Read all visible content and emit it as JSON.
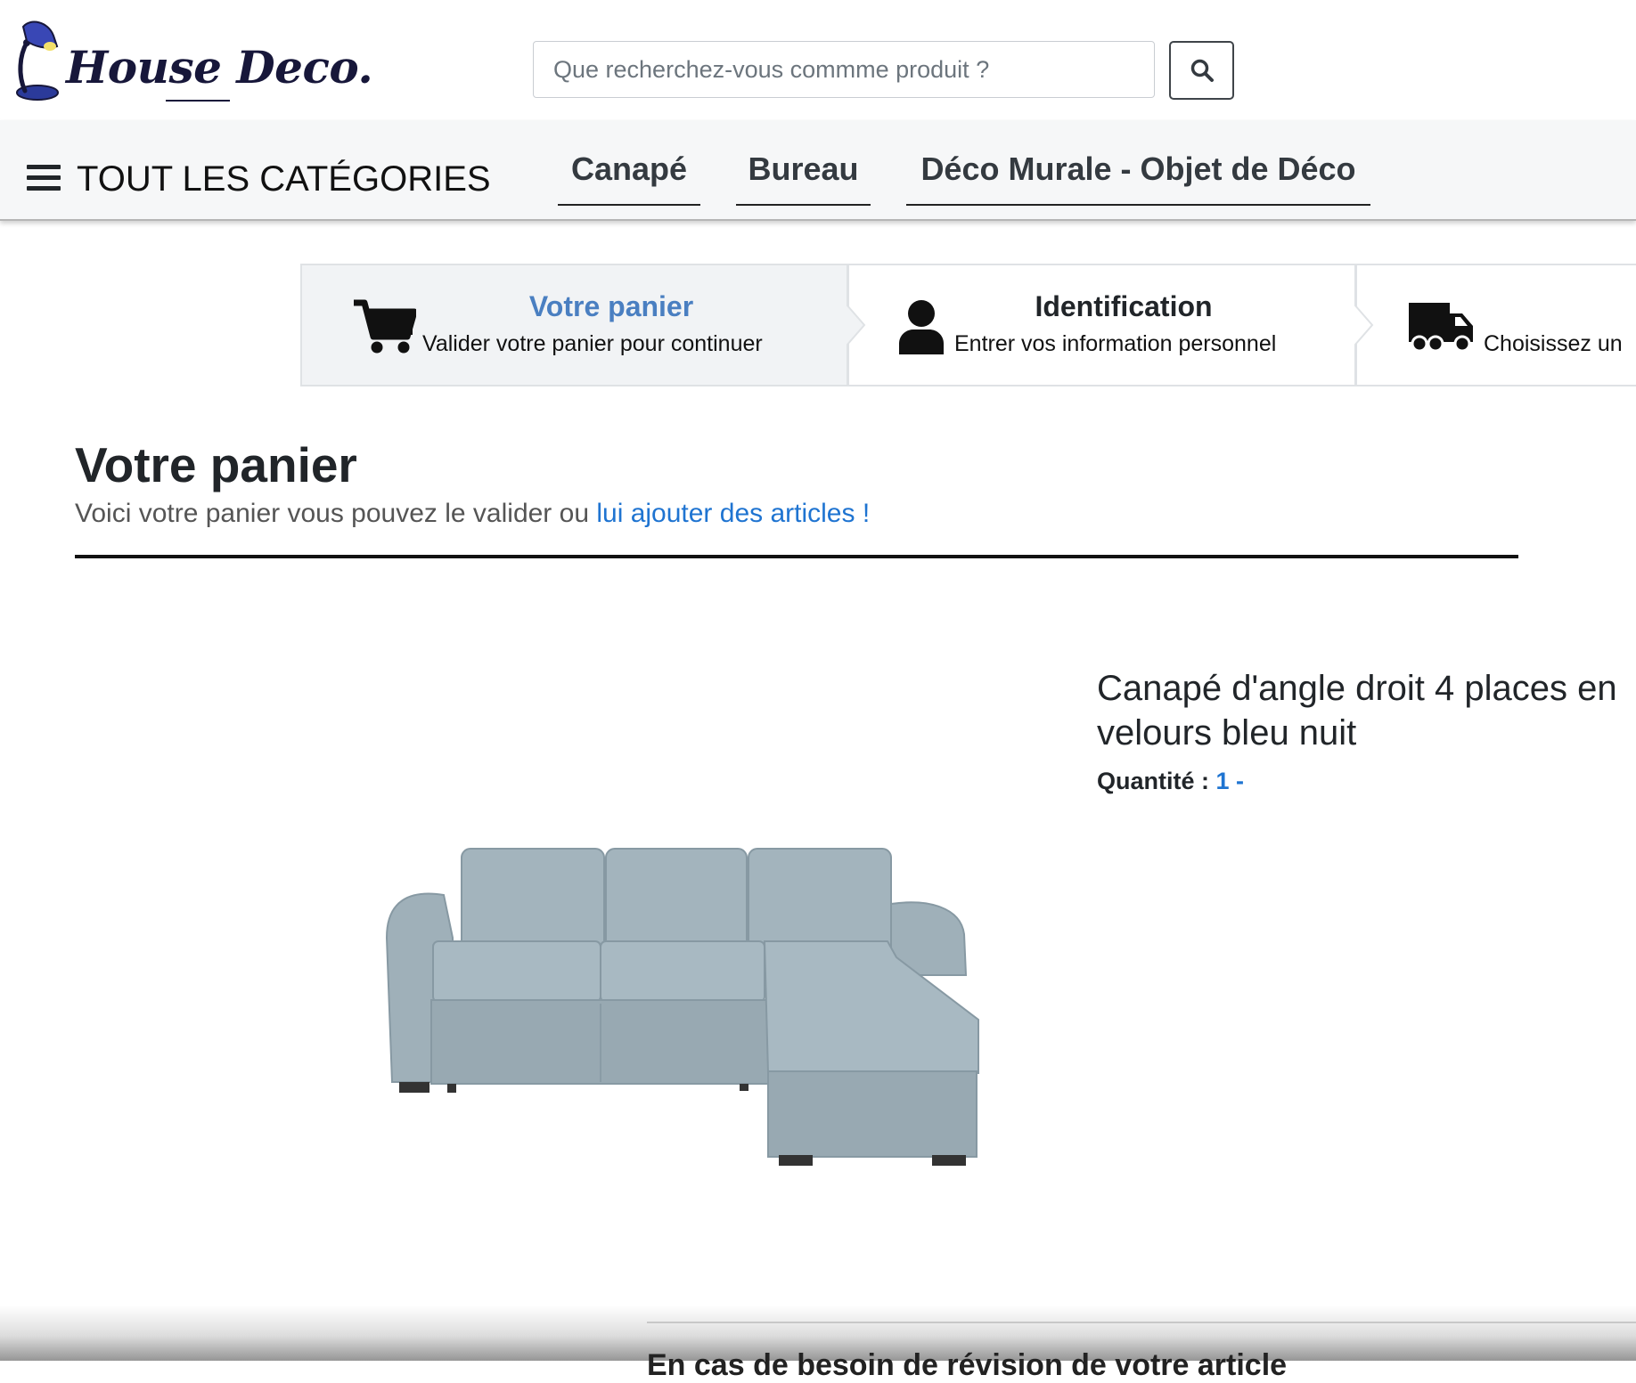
{
  "header": {
    "logo_text": "House Deco.",
    "search": {
      "placeholder": "Que recherchez-vous commme produit ?"
    }
  },
  "nav": {
    "categories_label": "TOUT LES CATÉGORIES",
    "links": [
      {
        "label": "Canapé"
      },
      {
        "label": "Bureau"
      },
      {
        "label": "Déco Murale - Objet de Déco"
      }
    ]
  },
  "stepper": {
    "steps": [
      {
        "icon": "cart-icon",
        "title": "Votre panier",
        "subtitle": "Valider votre panier pour continuer",
        "active": true
      },
      {
        "icon": "user-icon",
        "title": "Identification",
        "subtitle": "Entrer vos information personnel",
        "active": false
      },
      {
        "icon": "truck-icon",
        "title": "",
        "subtitle": "Choisissez un",
        "active": false
      }
    ]
  },
  "page": {
    "title": "Votre panier",
    "subtitle_text": "Voici votre panier vous pouvez le valider ou ",
    "subtitle_link": "lui ajouter des articles !"
  },
  "cart": {
    "items": [
      {
        "name_line1": "Canapé d'angle droit 4 places en",
        "name_line2": "velours bleu nuit",
        "quantity_label": "Quantité : ",
        "quantity_value": "1 -"
      }
    ]
  },
  "bottom": {
    "partial_text": "En cas de besoin de révision de votre article"
  },
  "colors": {
    "accent": "#1f74d1",
    "active_step": "#4a7fc1",
    "navbar_bg": "#f6f7f8",
    "logo": "#17173a"
  }
}
